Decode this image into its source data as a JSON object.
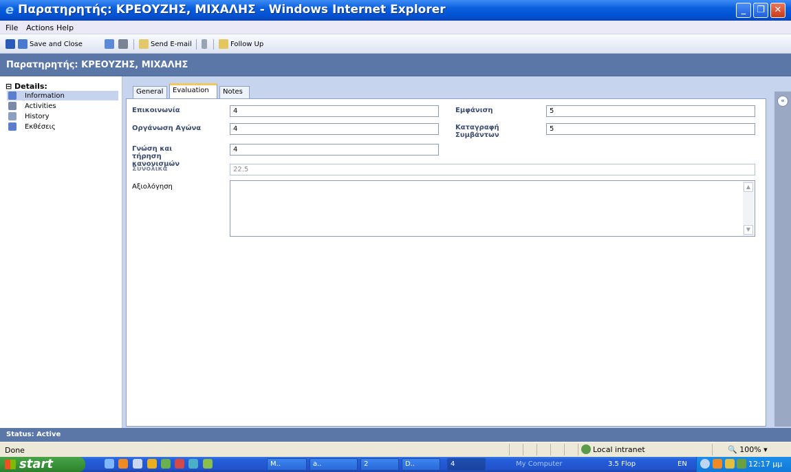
{
  "window": {
    "title": "Παρατηρητής: ΚΡΕΟΥΖΗΣ, ΜΙΧΑΛΗΣ - Windows Internet Explorer",
    "buttons": {
      "minimize": "_",
      "restore": "❐",
      "close": "✕"
    }
  },
  "menu": {
    "file": "File",
    "actions": "Actions",
    "help": "Help"
  },
  "toolbar": {
    "save_close": "Save and Close",
    "send_email": "Send E-mail",
    "follow_up": "Follow Up"
  },
  "form": {
    "header": "Παρατηρητής: ΚΡΕΟΥΖΗΣ, ΜΙΧΑΛΗΣ"
  },
  "nav": {
    "header": "⊟ Details:",
    "items": [
      "Information",
      "Activities",
      "History",
      "Εκθέσεις"
    ],
    "selected_index": 0
  },
  "tabs": {
    "general": "General",
    "evaluation": "Evaluation",
    "notes": "Notes",
    "active": "Evaluation"
  },
  "fields": {
    "epikoinonia": {
      "label": "Επικοινωνία",
      "value": "4"
    },
    "organosi": {
      "label": "Οργάνωση Αγώνα",
      "value": "4"
    },
    "gnosi": {
      "label": "Γνώση και τήρηση κανονισμών",
      "value": "4"
    },
    "emfanisi": {
      "label": "Εμφάνιση",
      "value": "5"
    },
    "katagrafi": {
      "label": "Καταγραφή Συμβάντων",
      "value": "5"
    },
    "synolika": {
      "label": "Συνολικά",
      "value": "22.5"
    },
    "axiologisi": {
      "label": "Αξιολόγηση",
      "value": ""
    }
  },
  "right_strip": {
    "collapse": "«"
  },
  "status": {
    "text": "Status: Active"
  },
  "ie_status": {
    "text": "Done",
    "zone": "Local intranet",
    "zoom": "100%"
  },
  "taskbar": {
    "start": "start",
    "tasks": [
      "M..",
      "a..",
      "2",
      "D..",
      "4"
    ],
    "my_computer": "My Computer",
    "floppy": "3.5 Flop",
    "lang": "EN",
    "clock": "12:17 μμ"
  },
  "colors": {
    "title_bar": "#0a5fdc",
    "form_header": "#5b77a8",
    "nav_selected": "#c6d3ee",
    "tab_accent": "#f1c85c"
  }
}
